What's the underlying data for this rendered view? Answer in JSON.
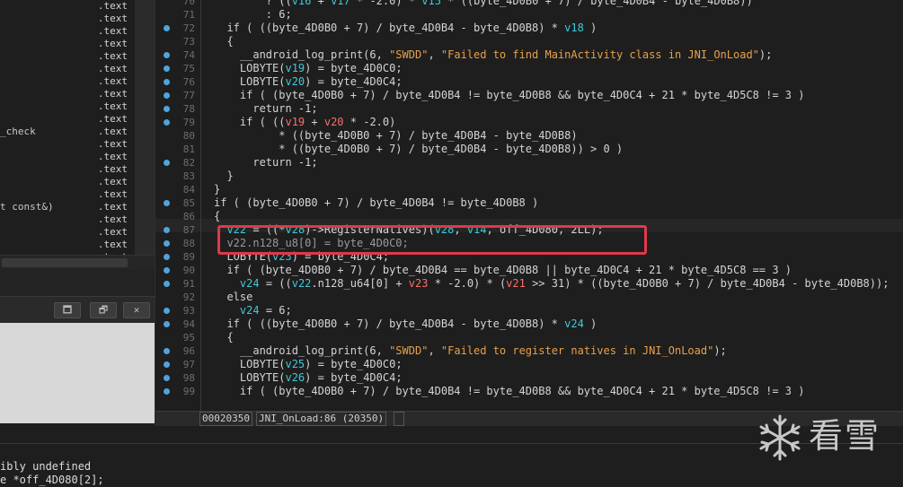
{
  "segments_panel": {
    "rows": [
      {
        "name": "",
        "segment": ".text"
      },
      {
        "name": "",
        "segment": ".text"
      },
      {
        "name": "",
        "segment": ".text"
      },
      {
        "name": "",
        "segment": ".text"
      },
      {
        "name": "",
        "segment": ".text"
      },
      {
        "name": "",
        "segment": ".text"
      },
      {
        "name": "",
        "segment": ".text"
      },
      {
        "name": "",
        "segment": ".text"
      },
      {
        "name": "",
        "segment": ".text"
      },
      {
        "name": "",
        "segment": ".text"
      },
      {
        "name": "_check",
        "segment": ".text"
      },
      {
        "name": "",
        "segment": ".text"
      },
      {
        "name": "",
        "segment": ".text"
      },
      {
        "name": "",
        "segment": ".text"
      },
      {
        "name": "",
        "segment": ".text"
      },
      {
        "name": "",
        "segment": ".text"
      },
      {
        "name": "t const&)",
        "segment": ".text"
      },
      {
        "name": "",
        "segment": ".text"
      },
      {
        "name": "",
        "segment": ".text"
      },
      {
        "name": "",
        "segment": ".text"
      },
      {
        "name": "",
        "segment": ".text"
      }
    ]
  },
  "dock_panel": {
    "buttons": [
      {
        "name": "maximize-button",
        "glyph": "🗖"
      },
      {
        "name": "restore-button",
        "glyph": "🗗"
      },
      {
        "name": "close-button",
        "glyph": "✕"
      }
    ]
  },
  "pseudocode": {
    "lines": [
      {
        "n": "70",
        "bp": false,
        "tokens": [
          [
            "        ? ((",
            "d"
          ],
          [
            "v16",
            "v"
          ],
          [
            " + ",
            "d"
          ],
          [
            "v17",
            "v"
          ],
          [
            " * -2.0) * ",
            "d"
          ],
          [
            "v15",
            "v"
          ],
          [
            " * ((byte_4D0B0 + 7) / byte_4D0B4 - byte_4D0B8))",
            "d"
          ]
        ]
      },
      {
        "n": "71",
        "bp": false,
        "tokens": [
          [
            "        : 6;",
            "d"
          ]
        ]
      },
      {
        "n": "72",
        "bp": true,
        "tokens": [
          [
            "  if ( ((byte_4D0B0 + 7) / byte_4D0B4 - byte_4D0B8) * ",
            "d"
          ],
          [
            "v18",
            "v"
          ],
          [
            " )",
            "d"
          ]
        ]
      },
      {
        "n": "73",
        "bp": false,
        "tokens": [
          [
            "  {",
            "d"
          ]
        ]
      },
      {
        "n": "74",
        "bp": true,
        "tokens": [
          [
            "    __android_log_print(6, ",
            "d"
          ],
          [
            "\"SWDD\"",
            "s"
          ],
          [
            ", ",
            "d"
          ],
          [
            "\"Failed to find MainActivity class in JNI_OnLoad\"",
            "s"
          ],
          [
            ");",
            "d"
          ]
        ]
      },
      {
        "n": "75",
        "bp": true,
        "tokens": [
          [
            "    LOBYTE(",
            "d"
          ],
          [
            "v19",
            "v"
          ],
          [
            ") = byte_4D0C0;",
            "d"
          ]
        ]
      },
      {
        "n": "76",
        "bp": true,
        "tokens": [
          [
            "    LOBYTE(",
            "d"
          ],
          [
            "v20",
            "v"
          ],
          [
            ") = byte_4D0C4;",
            "d"
          ]
        ]
      },
      {
        "n": "77",
        "bp": true,
        "tokens": [
          [
            "    if ( (byte_4D0B0 + 7) / byte_4D0B4 != byte_4D0B8 && byte_4D0C4 + 21 * byte_4D5C8 != 3 )",
            "d"
          ]
        ]
      },
      {
        "n": "78",
        "bp": true,
        "tokens": [
          [
            "      return -1;",
            "d"
          ]
        ]
      },
      {
        "n": "79",
        "bp": true,
        "tokens": [
          [
            "    if ( ((",
            "d"
          ],
          [
            "v19",
            "r"
          ],
          [
            " + ",
            "d"
          ],
          [
            "v20",
            "r"
          ],
          [
            " * -2.0)",
            "d"
          ]
        ]
      },
      {
        "n": "80",
        "bp": false,
        "tokens": [
          [
            "          * ((byte_4D0B0 + 7) / byte_4D0B4 - byte_4D0B8)",
            "d"
          ]
        ]
      },
      {
        "n": "81",
        "bp": false,
        "tokens": [
          [
            "          * ((byte_4D0B0 + 7) / byte_4D0B4 - byte_4D0B8)) > 0 )",
            "d"
          ]
        ]
      },
      {
        "n": "82",
        "bp": true,
        "tokens": [
          [
            "      return -1;",
            "d"
          ]
        ]
      },
      {
        "n": "83",
        "bp": false,
        "tokens": [
          [
            "  }",
            "d"
          ]
        ]
      },
      {
        "n": "84",
        "bp": false,
        "tokens": [
          [
            "}",
            "d"
          ]
        ]
      },
      {
        "n": "85",
        "bp": true,
        "tokens": [
          [
            "if ( (byte_4D0B0 + 7) / byte_4D0B4 != byte_4D0B8 )",
            "d"
          ]
        ]
      },
      {
        "n": "86",
        "bp": false,
        "tokens": [
          [
            "{",
            "d"
          ]
        ]
      },
      {
        "n": "87",
        "bp": true,
        "tokens": [
          [
            "  ",
            "d"
          ],
          [
            "v22",
            "v"
          ],
          [
            " = ((*",
            "d"
          ],
          [
            "v28",
            "v"
          ],
          [
            ")->RegisterNatives)(",
            "d"
          ],
          [
            "v28",
            "v"
          ],
          [
            ", ",
            "d"
          ],
          [
            "v14",
            "v"
          ],
          [
            ", off_4D080, 2LL);",
            "d"
          ]
        ]
      },
      {
        "n": "88",
        "bp": true,
        "tokens": [
          [
            "  v22.n128_u8[0] = byte_4D0C0;",
            "m"
          ]
        ]
      },
      {
        "n": "89",
        "bp": true,
        "tokens": [
          [
            "  LOBYTE(",
            "d"
          ],
          [
            "v23",
            "v"
          ],
          [
            ") = byte_4D0C4;",
            "d"
          ]
        ]
      },
      {
        "n": "90",
        "bp": true,
        "tokens": [
          [
            "  if ( (byte_4D0B0 + 7) / byte_4D0B4 == byte_4D0B8 || byte_4D0C4 + 21 * byte_4D5C8 == 3 )",
            "d"
          ]
        ]
      },
      {
        "n": "91",
        "bp": true,
        "tokens": [
          [
            "    ",
            "d"
          ],
          [
            "v24",
            "v"
          ],
          [
            " = ((",
            "d"
          ],
          [
            "v22",
            "v"
          ],
          [
            ".n128_u64[0] + ",
            "d"
          ],
          [
            "v23",
            "r"
          ],
          [
            " * -2.0) * (",
            "d"
          ],
          [
            "v21",
            "r"
          ],
          [
            " >> 31) * ((byte_4D0B0 + 7) / byte_4D0B4 - byte_4D0B8));",
            "d"
          ]
        ]
      },
      {
        "n": "92",
        "bp": false,
        "tokens": [
          [
            "  else",
            "d"
          ]
        ]
      },
      {
        "n": "93",
        "bp": true,
        "tokens": [
          [
            "    ",
            "d"
          ],
          [
            "v24",
            "v"
          ],
          [
            " = 6;",
            "d"
          ]
        ]
      },
      {
        "n": "94",
        "bp": true,
        "tokens": [
          [
            "  if ( ((byte_4D0B0 + 7) / byte_4D0B4 - byte_4D0B8) * ",
            "d"
          ],
          [
            "v24",
            "v"
          ],
          [
            " )",
            "d"
          ]
        ]
      },
      {
        "n": "95",
        "bp": false,
        "tokens": [
          [
            "  {",
            "d"
          ]
        ]
      },
      {
        "n": "96",
        "bp": true,
        "tokens": [
          [
            "    __android_log_print(6, ",
            "d"
          ],
          [
            "\"SWDD\"",
            "s"
          ],
          [
            ", ",
            "d"
          ],
          [
            "\"Failed to register natives in JNI_OnLoad\"",
            "s"
          ],
          [
            ");",
            "d"
          ]
        ]
      },
      {
        "n": "97",
        "bp": true,
        "tokens": [
          [
            "    LOBYTE(",
            "d"
          ],
          [
            "v25",
            "v"
          ],
          [
            ") = byte_4D0C0;",
            "d"
          ]
        ]
      },
      {
        "n": "98",
        "bp": true,
        "tokens": [
          [
            "    LOBYTE(",
            "d"
          ],
          [
            "v26",
            "v"
          ],
          [
            ") = byte_4D0C4;",
            "d"
          ]
        ]
      },
      {
        "n": "99",
        "bp": true,
        "tokens": [
          [
            "    if ( (byte_4D0B0 + 7) / byte_4D0B4 != byte_4D0B8 && byte_4D0C4 + 21 * byte_4D5C8 != 3 )",
            "d"
          ]
        ]
      }
    ]
  },
  "status_bar": {
    "address": "00020350",
    "location": "JNI_OnLoad:86 (20350)"
  },
  "output": {
    "lines": [
      "ibly undefined",
      "e *off_4D080[2];"
    ]
  },
  "watermark": {
    "text": "看雪",
    "icon": "snowflake-icon"
  },
  "colors": {
    "variable": "#3fc9d8",
    "variable_alt": "#ff6b6b",
    "string": "#e7a14a",
    "breakpoint": "#4fa3e0",
    "highlight_box": "#e0384a"
  }
}
